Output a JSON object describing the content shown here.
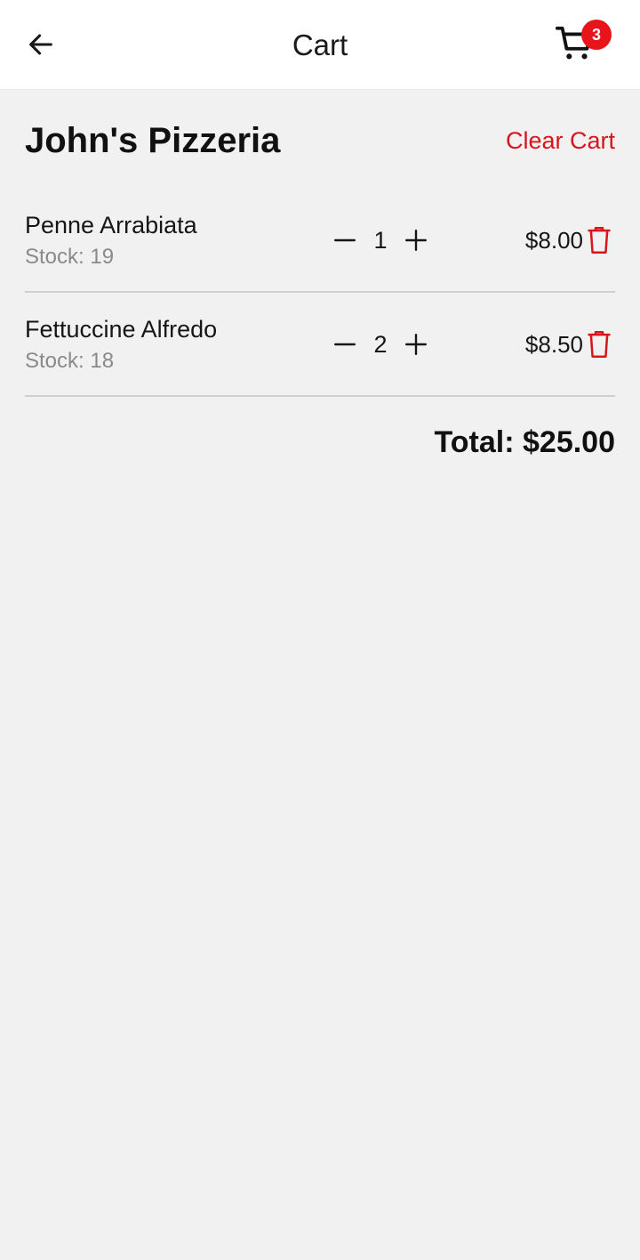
{
  "header": {
    "title": "Cart",
    "back_icon": "arrow-left-icon",
    "cart_icon": "shopping-cart-icon",
    "cart_badge_count": "3",
    "badge_color": "#e8141a"
  },
  "store": {
    "name": "John's Pizzeria",
    "clear_cart_label": "Clear Cart",
    "accent_color": "#d7161b"
  },
  "items": [
    {
      "name": "Penne Arrabiata",
      "stock": "Stock: 19",
      "quantity": "1",
      "price": "$8.00",
      "minus_icon": "minus-icon",
      "plus_icon": "plus-icon",
      "delete_icon": "trash-icon"
    },
    {
      "name": "Fettuccine Alfredo",
      "stock": "Stock: 18",
      "quantity": "2",
      "price": "$8.50",
      "minus_icon": "minus-icon",
      "plus_icon": "plus-icon",
      "delete_icon": "trash-icon"
    }
  ],
  "summary": {
    "total": "Total: $25.00"
  }
}
